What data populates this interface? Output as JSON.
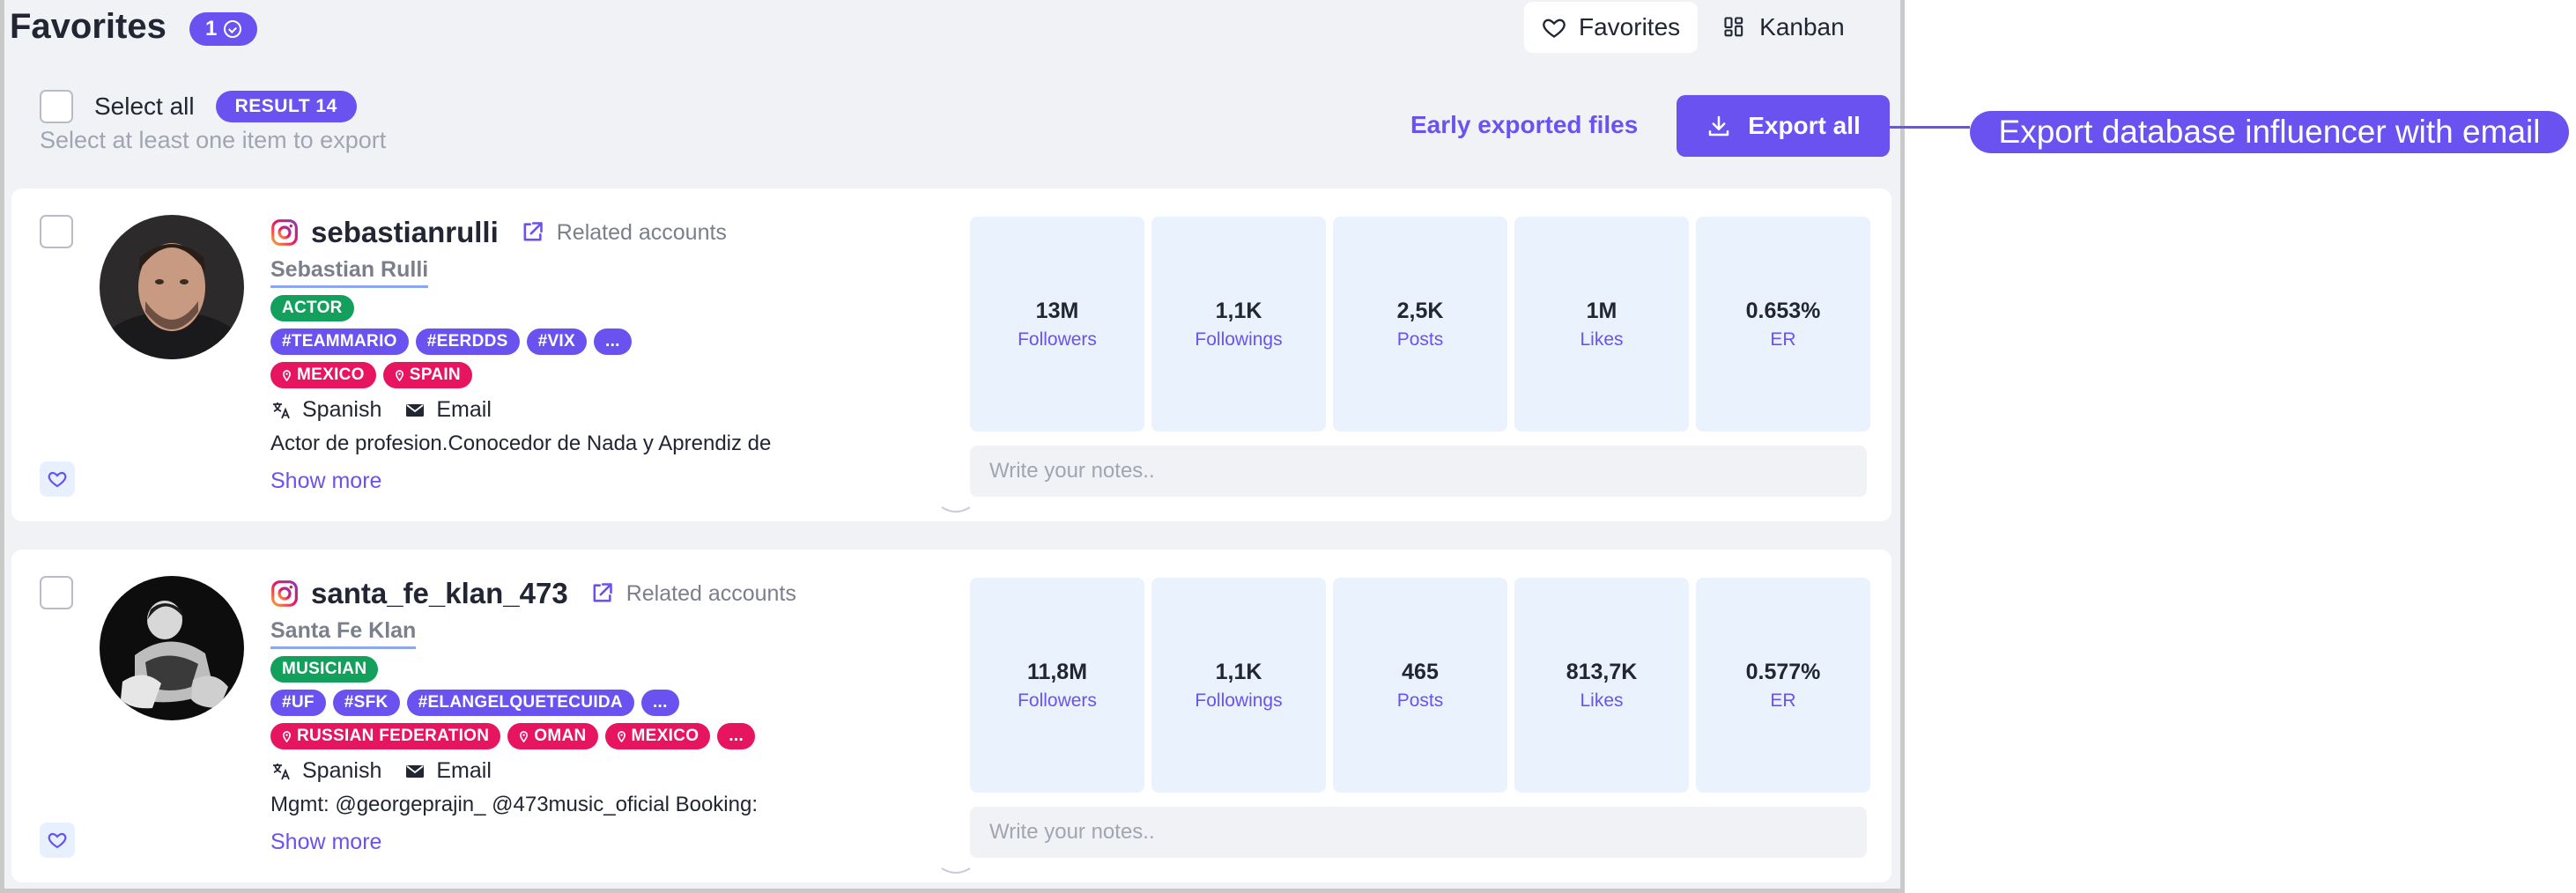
{
  "header": {
    "title": "Favorites",
    "count": "1",
    "views": [
      {
        "label": "Favorites",
        "icon": "heart-icon",
        "active": true
      },
      {
        "label": "Kanban",
        "icon": "kanban-icon",
        "active": false
      }
    ]
  },
  "toolbar": {
    "select_all_label": "Select all",
    "result_badge": "RESULT 14",
    "hint": "Select at least one item to export",
    "early_exported_label": "Early exported files",
    "export_label": "Export all"
  },
  "callout": "Export database influencer with email",
  "cards": [
    {
      "username": "sebastianrulli",
      "related": "Related accounts",
      "fullname": "Sebastian Rulli",
      "category": "ACTOR",
      "hashtags": [
        "#TEAMMARIO",
        "#EERDDS",
        "#VIX",
        "..."
      ],
      "locations": [
        "MEXICO",
        "SPAIN"
      ],
      "language": "Spanish",
      "email_label": "Email",
      "bio": "Actor de profesion.Conocedor de Nada y Aprendiz de",
      "show_more": "Show more",
      "stats": [
        {
          "value": "13M",
          "label": "Followers"
        },
        {
          "value": "1,1K",
          "label": "Followings"
        },
        {
          "value": "2,5K",
          "label": "Posts"
        },
        {
          "value": "1M",
          "label": "Likes"
        },
        {
          "value": "0.653%",
          "label": "ER"
        }
      ],
      "notes_placeholder": "Write your notes.."
    },
    {
      "username": "santa_fe_klan_473",
      "related": "Related accounts",
      "fullname": "Santa Fe Klan",
      "category": "MUSICIAN",
      "hashtags": [
        "#UF",
        "#SFK",
        "#ELANGELQUETECUIDA",
        "..."
      ],
      "locations": [
        "RUSSIAN FEDERATION",
        "OMAN",
        "MEXICO",
        "..."
      ],
      "language": "Spanish",
      "email_label": "Email",
      "bio": "Mgmt: @georgeprajin_ @473music_oficial Booking:",
      "show_more": "Show more",
      "stats": [
        {
          "value": "11,8M",
          "label": "Followers"
        },
        {
          "value": "1,1K",
          "label": "Followings"
        },
        {
          "value": "465",
          "label": "Posts"
        },
        {
          "value": "813,7K",
          "label": "Likes"
        },
        {
          "value": "0.577%",
          "label": "ER"
        }
      ],
      "notes_placeholder": "Write your notes.."
    }
  ],
  "colors": {
    "accent": "#6a52f0",
    "category": "#12a05c",
    "location": "#e7155f",
    "stat_bg": "#eaf3fd",
    "page_bg": "#f1f2f6"
  }
}
